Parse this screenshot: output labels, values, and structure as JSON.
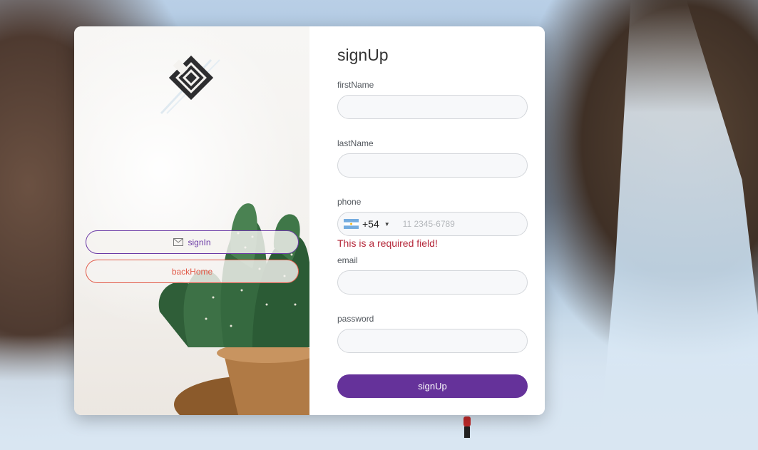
{
  "form": {
    "title": "signUp",
    "fields": {
      "firstName": {
        "label": "firstName",
        "value": ""
      },
      "lastName": {
        "label": "lastName",
        "value": ""
      },
      "phone": {
        "label": "phone",
        "country_flag": "argentina-flag-icon",
        "dial_code": "+54",
        "placeholder": "11 2345-6789",
        "value": "",
        "error": "This is a required field!"
      },
      "email": {
        "label": "email",
        "value": ""
      },
      "password": {
        "label": "password",
        "value": ""
      }
    },
    "submit_label": "signUp"
  },
  "side_panel": {
    "signin_label": "signIn",
    "signin_icon": "mail-icon",
    "backhome_label": "backHome"
  },
  "colors": {
    "accent": "#65329a",
    "signin_border": "#6b3aa6",
    "backhome": "#e25b4a",
    "error": "#b5283a"
  }
}
